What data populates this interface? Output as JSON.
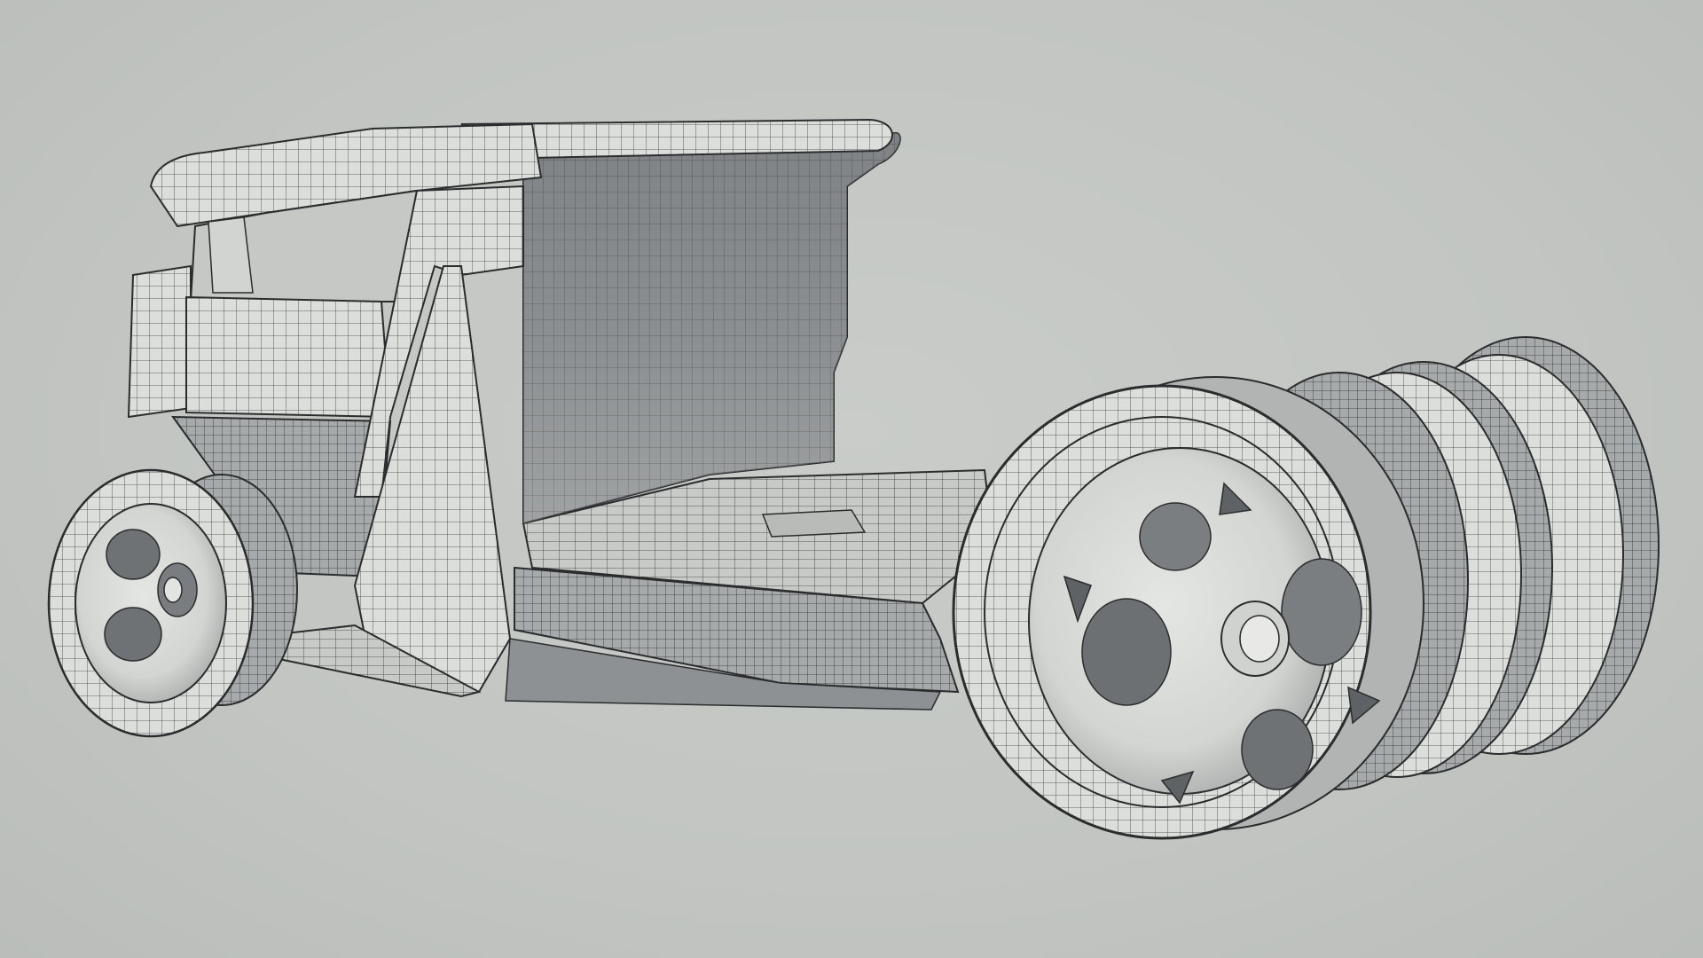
{
  "scene": {
    "background_color": "#c3c6c3",
    "surface_color": "#d9dbd8",
    "shadow_color": "#6e7173",
    "wire_color": "#2a2c2d",
    "objects": [
      "rear-left-wheel",
      "rear-right-wheel",
      "front-left-wheel",
      "front-right-wheel",
      "driver-cab",
      "seat-backrest",
      "floor-deck",
      "side-panel",
      "chassis-underside"
    ]
  }
}
